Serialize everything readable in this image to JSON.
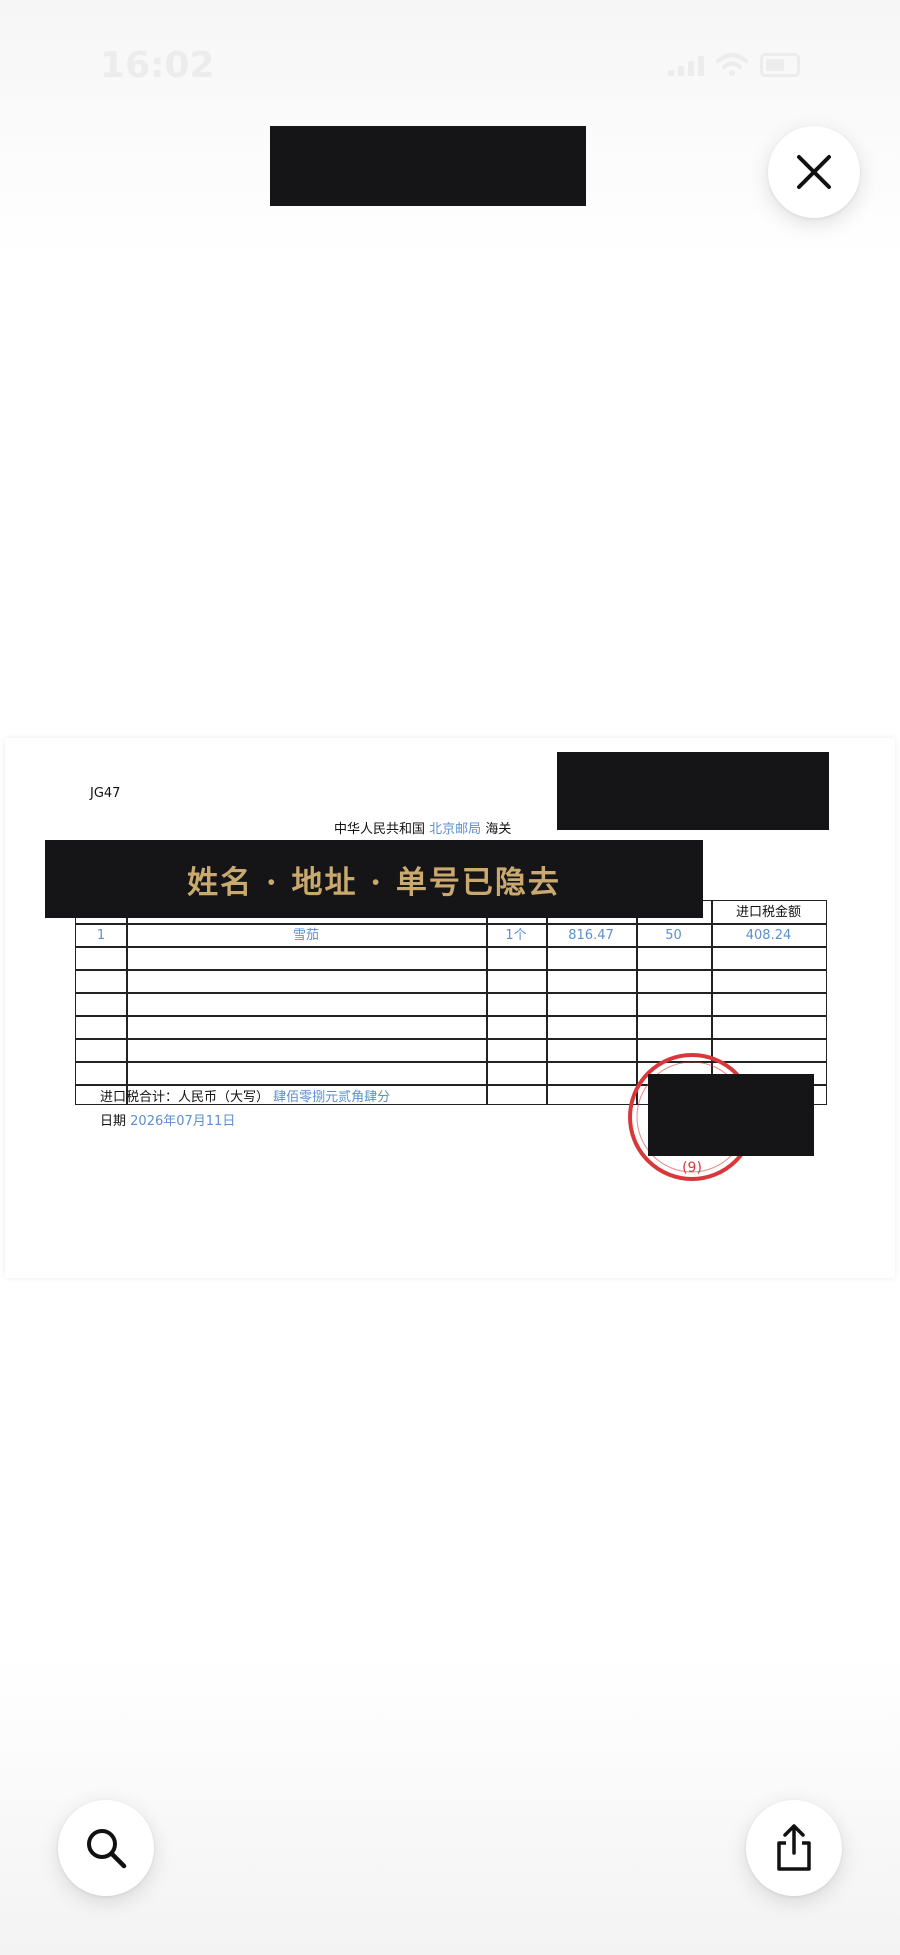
{
  "status_bar": {
    "time": "16:02"
  },
  "header": {
    "title_redacted": "[redacted]"
  },
  "controls": {
    "close_icon": "close-icon",
    "search_icon": "search-icon",
    "share_icon": "share-icon"
  },
  "document": {
    "code": "JG47",
    "authority_prefix": "中华人民共和国",
    "authority_place": "北京邮局",
    "authority_suffix": "海关",
    "banner_text": "姓名 · 地址 · 单号已隐去",
    "top_right_redacted": "[redacted]",
    "stamp_redacted": "[redacted]",
    "table": {
      "visible_header": "进口税金额",
      "rows": [
        {
          "no": "1",
          "item": "雪茄",
          "qty": "1个",
          "value": "816.47",
          "rate": "50",
          "tax": "408.24"
        }
      ],
      "empty_rows": 6
    },
    "total_label": "进口税合计：人民币（大写）",
    "total_value": "肆佰零捌元贰角肆分",
    "date_label": "日期",
    "date_value": "2026年07月11日",
    "stamp_number": "(9)"
  },
  "colors": {
    "accent_blue": "#5b8fd0",
    "stamp_red": "#d9383a",
    "redaction": "#151517",
    "banner_gold": "#c9a96e"
  }
}
